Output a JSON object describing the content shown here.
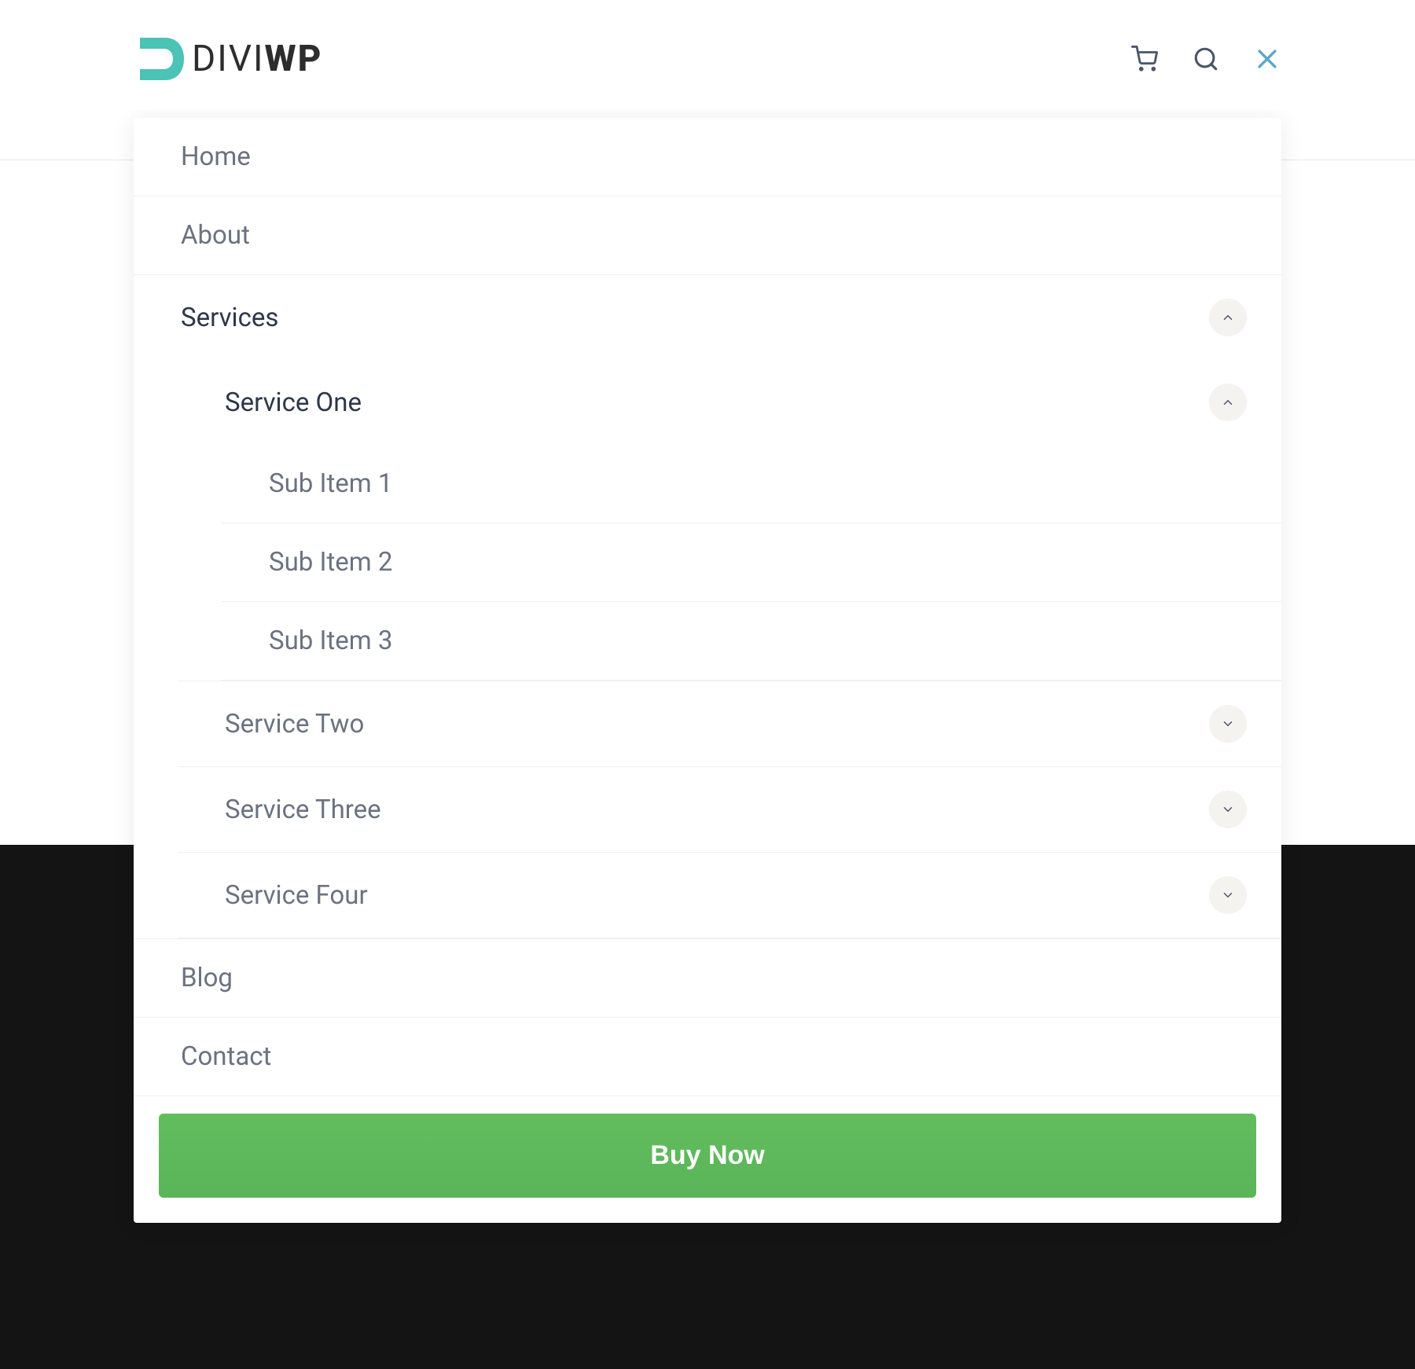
{
  "brand": {
    "part1": "DIVI",
    "part2": "WP"
  },
  "menu": {
    "home": "Home",
    "about": "About",
    "services": {
      "label": "Services",
      "expanded": true,
      "items": [
        {
          "label": "Service One",
          "expanded": true,
          "children": [
            {
              "label": "Sub Item 1"
            },
            {
              "label": "Sub Item 2"
            },
            {
              "label": "Sub Item 3"
            }
          ]
        },
        {
          "label": "Service Two",
          "expanded": false
        },
        {
          "label": "Service Three",
          "expanded": false
        },
        {
          "label": "Service Four",
          "expanded": false
        }
      ]
    },
    "blog": "Blog",
    "contact": "Contact"
  },
  "cta": {
    "label": "Buy Now"
  },
  "colors": {
    "accent": "#4bc3b5",
    "cta": "#5cb85c",
    "close": "#5ba7c9",
    "text_muted": "#6b7280",
    "text_active": "#2d3748"
  }
}
